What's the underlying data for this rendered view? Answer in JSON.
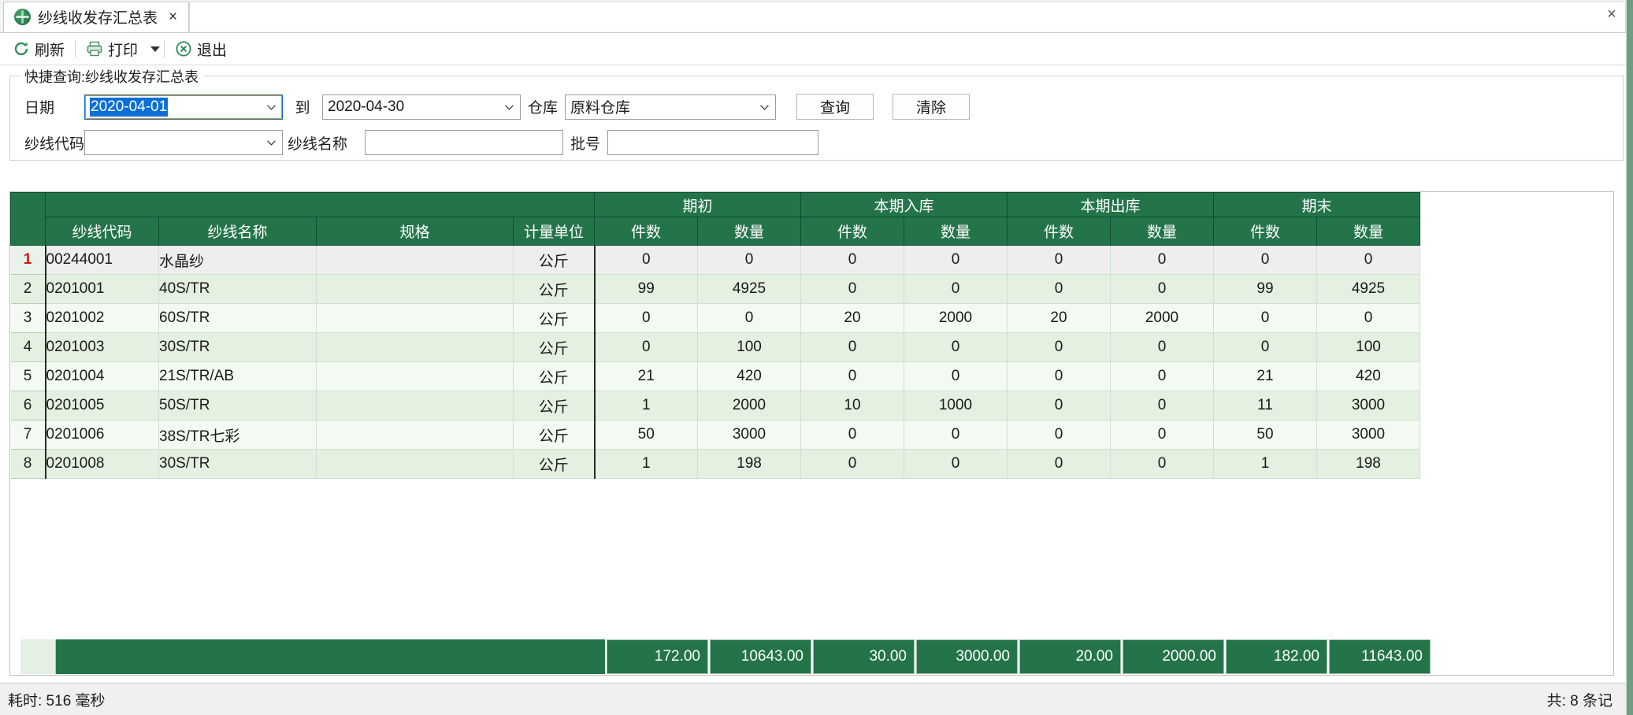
{
  "window": {
    "close_label": "×"
  },
  "tab": {
    "title": "纱线收发存汇总表",
    "close_label": "×",
    "icon": "globe-icon"
  },
  "toolbar": {
    "refresh_label": "刷新",
    "print_label": "打印",
    "exit_label": "退出",
    "refresh_icon": "refresh-icon",
    "print_icon": "printer-icon",
    "exit_icon": "exit-circle-icon",
    "print_caret_icon": "chevron-down-icon"
  },
  "query": {
    "legend": "快捷查询:纱线收发存汇总表",
    "date_label": "日期",
    "date_from": "2020-04-01",
    "to_label": "到",
    "date_to": "2020-04-30",
    "warehouse_label": "仓库",
    "warehouse_value": "原料仓库",
    "search_button": "查询",
    "clear_button": "清除",
    "yarn_code_label": "纱线代码",
    "yarn_code_value": "",
    "yarn_name_label": "纱线名称",
    "yarn_name_value": "",
    "batch_label": "批号",
    "batch_value": ""
  },
  "grid": {
    "group_headers": [
      "期初",
      "本期入库",
      "本期出库",
      "期末"
    ],
    "sub_headers": [
      "件数",
      "数量"
    ],
    "columns": [
      "纱线代码",
      "纱线名称",
      "规格",
      "计量单位"
    ],
    "rows": [
      {
        "no": "1",
        "code": "00244001",
        "name": "水晶纱",
        "spec": "",
        "unit": "公斤",
        "values": [
          "0",
          "0",
          "0",
          "0",
          "0",
          "0",
          "0",
          "0"
        ],
        "selected": true
      },
      {
        "no": "2",
        "code": "0201001",
        "name": "40S/TR",
        "spec": "",
        "unit": "公斤",
        "values": [
          "99",
          "4925",
          "0",
          "0",
          "0",
          "0",
          "99",
          "4925"
        ],
        "selected": false
      },
      {
        "no": "3",
        "code": "0201002",
        "name": "60S/TR",
        "spec": "",
        "unit": "公斤",
        "values": [
          "0",
          "0",
          "20",
          "2000",
          "20",
          "2000",
          "0",
          "0"
        ],
        "selected": false
      },
      {
        "no": "4",
        "code": "0201003",
        "name": "30S/TR",
        "spec": "",
        "unit": "公斤",
        "values": [
          "0",
          "100",
          "0",
          "0",
          "0",
          "0",
          "0",
          "100"
        ],
        "selected": false
      },
      {
        "no": "5",
        "code": "0201004",
        "name": "21S/TR/AB",
        "spec": "",
        "unit": "公斤",
        "values": [
          "21",
          "420",
          "0",
          "0",
          "0",
          "0",
          "21",
          "420"
        ],
        "selected": false
      },
      {
        "no": "6",
        "code": "0201005",
        "name": "50S/TR",
        "spec": "",
        "unit": "公斤",
        "values": [
          "1",
          "2000",
          "10",
          "1000",
          "0",
          "0",
          "11",
          "3000"
        ],
        "selected": false
      },
      {
        "no": "7",
        "code": "0201006",
        "name": "38S/TR七彩",
        "spec": "",
        "unit": "公斤",
        "values": [
          "50",
          "3000",
          "0",
          "0",
          "0",
          "0",
          "50",
          "3000"
        ],
        "selected": false
      },
      {
        "no": "8",
        "code": "0201008",
        "name": "30S/TR",
        "spec": "",
        "unit": "公斤",
        "values": [
          "1",
          "198",
          "0",
          "0",
          "0",
          "0",
          "1",
          "198"
        ],
        "selected": false
      }
    ],
    "totals": [
      "172.00",
      "10643.00",
      "30.00",
      "3000.00",
      "20.00",
      "2000.00",
      "182.00",
      "11643.00"
    ]
  },
  "status": {
    "left": "耗时: 516 毫秒",
    "right": "共: 8 条记"
  },
  "colors": {
    "header_green": "#24744a",
    "row_even": "#e4f0e0",
    "row_odd": "#f2faf1",
    "selection_blue": "#0b6fd8",
    "accent_red": "#d01717"
  }
}
